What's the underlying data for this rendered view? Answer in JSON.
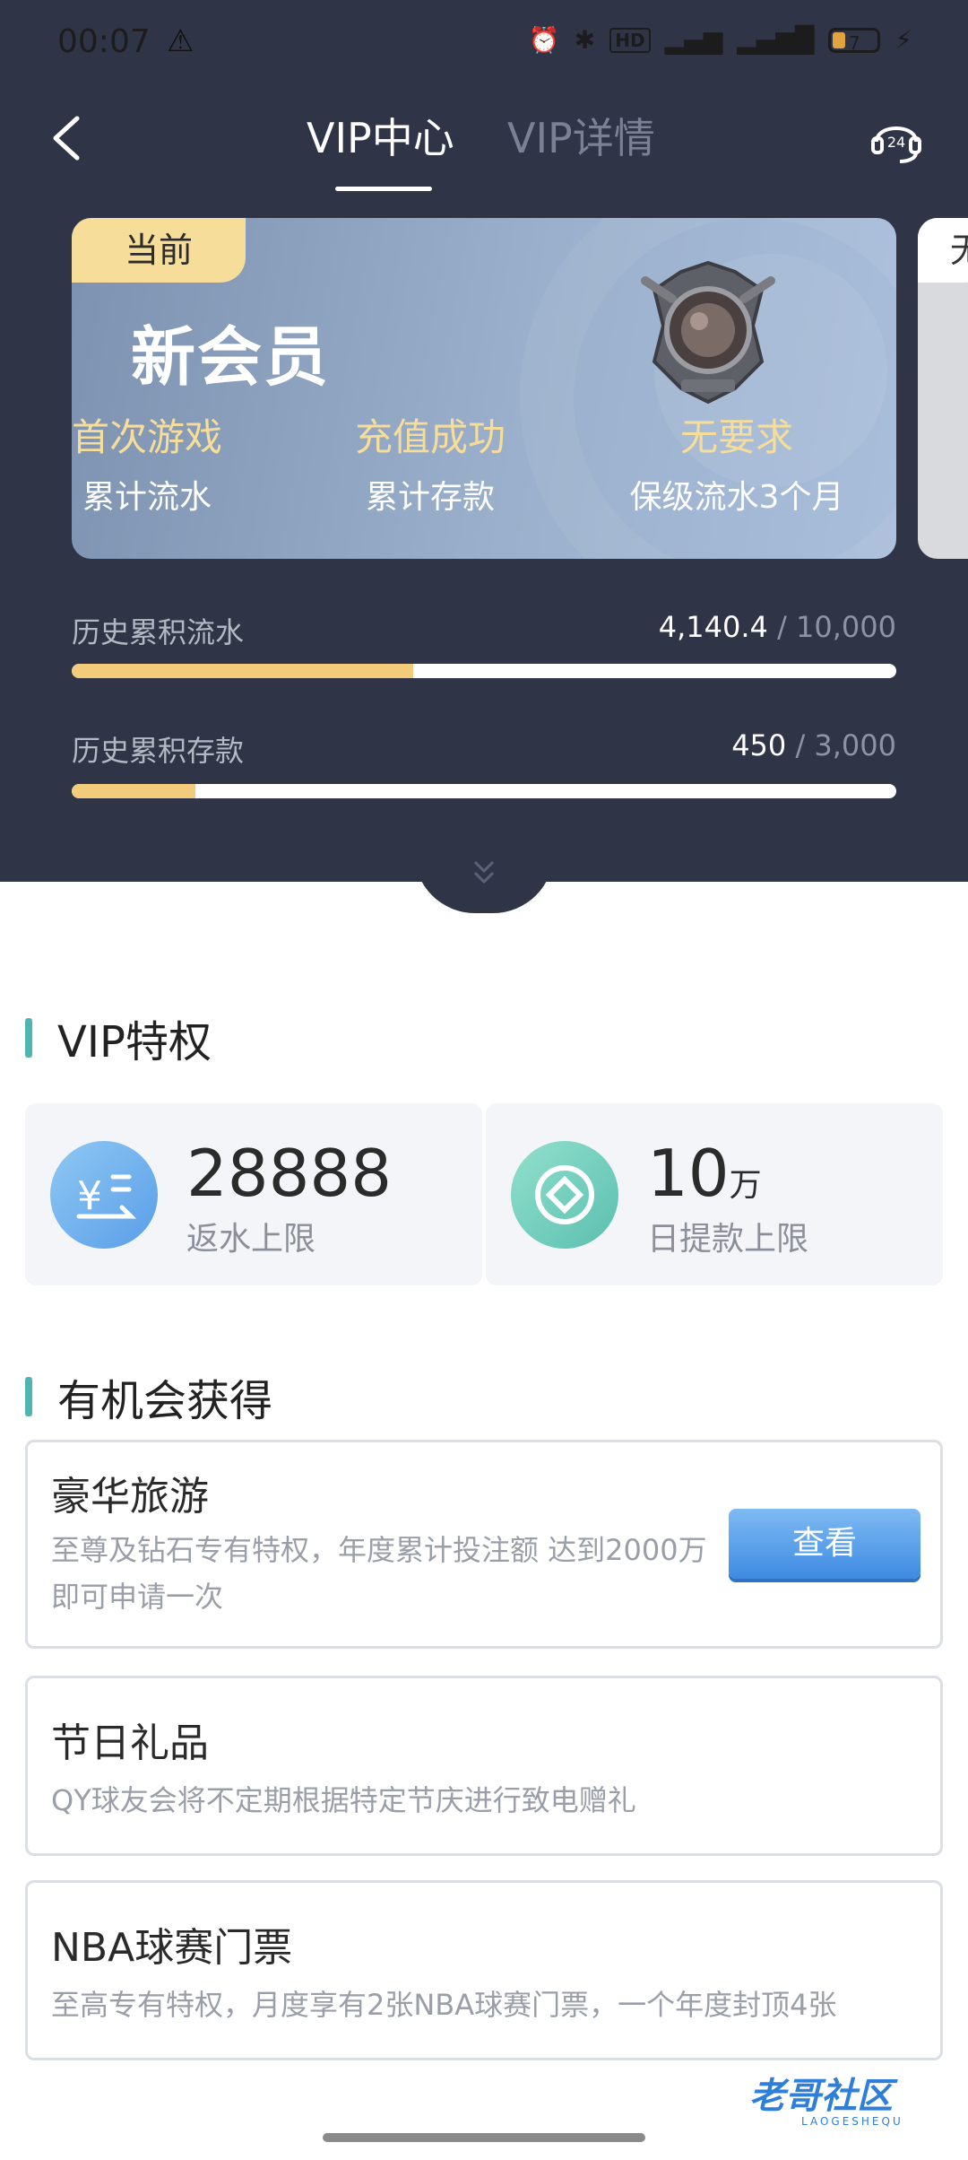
{
  "status_bar": {
    "time": "00:07",
    "battery": "7",
    "hd": "HD"
  },
  "nav": {
    "tab_active": "VIP中心",
    "tab_inactive": "VIP详情"
  },
  "vip_card": {
    "badge": "当前",
    "level_name": "新会员",
    "requirements": [
      {
        "value": "首次游戏",
        "label": "累计流水"
      },
      {
        "value": "充值成功",
        "label": "累计存款"
      },
      {
        "value": "无要求",
        "label": "保级流水3个月"
      }
    ],
    "next_card_badge": "无"
  },
  "progress": [
    {
      "label": "历史累积流水",
      "current": "4,140.4",
      "sep": " / ",
      "total": "10,000",
      "fraction": 0.414
    },
    {
      "label": "历史累积存款",
      "current": "450",
      "sep": " / ",
      "total": "3,000",
      "fraction": 0.15
    }
  ],
  "privileges": {
    "title": "VIP特权",
    "items": [
      {
        "value": "28888",
        "unit": "",
        "label": "返水上限"
      },
      {
        "value": "10",
        "unit": "万",
        "label": "日提款上限"
      }
    ]
  },
  "opportunities": {
    "title": "有机会获得",
    "items": [
      {
        "title": "豪华旅游",
        "desc_line1": "至尊及钻石专有特权，年度累计投注额 达到2000万",
        "desc_line2": "即可申请一次",
        "button": "查看"
      },
      {
        "title": "节日礼品",
        "desc_line1": "QY球友会将不定期根据特定节庆进行致电赠礼"
      },
      {
        "title": "NBA球赛门票",
        "desc_line1": "至高专有特权，月度享有2张NBA球赛门票，一个年度封顶4张"
      }
    ]
  },
  "watermark": {
    "text": "老哥社区",
    "sub": "LAOGESHEQU"
  },
  "colors": {
    "header_bg": "#2f3546",
    "accent_gold": "#f6dd99",
    "accent_teal": "#4fb5ad",
    "button_blue": "#3e8be2"
  }
}
